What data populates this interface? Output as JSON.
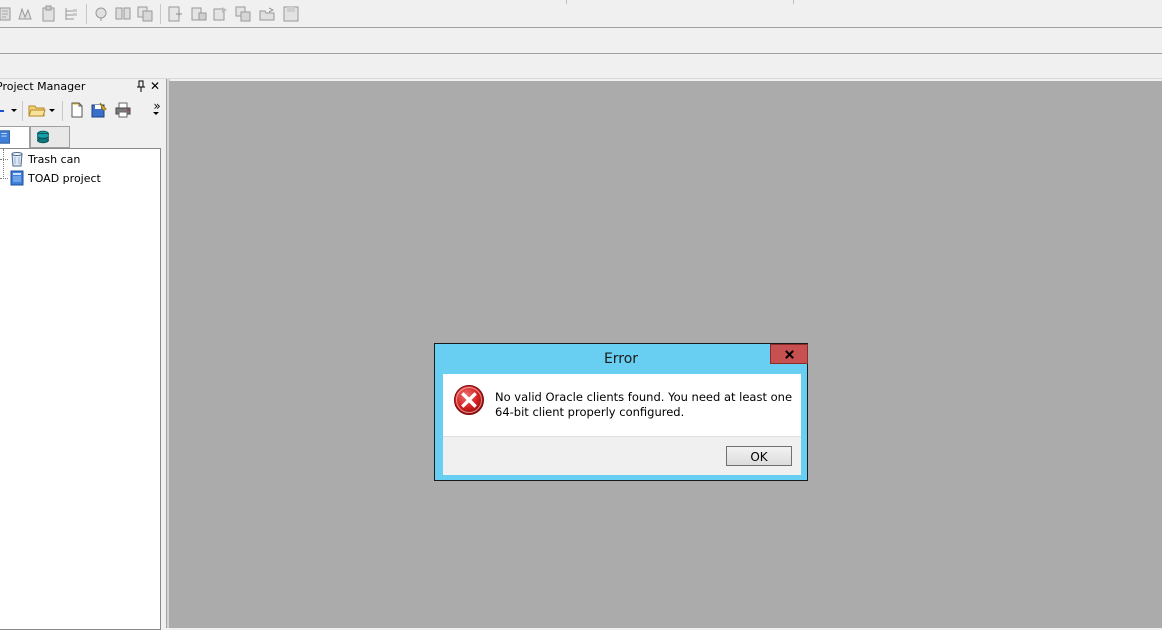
{
  "toolbar": {
    "icons": [
      "toolbar-icon-1",
      "toolbar-icon-2",
      "toolbar-icon-3",
      "toolbar-icon-4",
      "toolbar-icon-5",
      "toolbar-icon-6",
      "toolbar-icon-7",
      "toolbar-icon-8",
      "toolbar-icon-9",
      "toolbar-icon-10",
      "toolbar-icon-11",
      "toolbar-icon-12",
      "toolbar-icon-13"
    ]
  },
  "project_manager": {
    "title": "Project Manager",
    "pin_glyph": "■",
    "close_glyph": "✕",
    "more_glyph": "»",
    "tree": [
      {
        "label": "Trash can",
        "icon": "trash-can-icon"
      },
      {
        "label": "TOAD project",
        "icon": "project-icon"
      }
    ]
  },
  "dialog": {
    "title": "Error",
    "close_glyph": "✖",
    "message_line1": "No valid Oracle clients found. You need at least one",
    "message_line2": "64-bit client properly configured.",
    "ok_label": "OK",
    "icon": "error-icon",
    "colors": {
      "frame": "#68cff2",
      "close": "#c75050",
      "workspace": "#ababab"
    }
  }
}
